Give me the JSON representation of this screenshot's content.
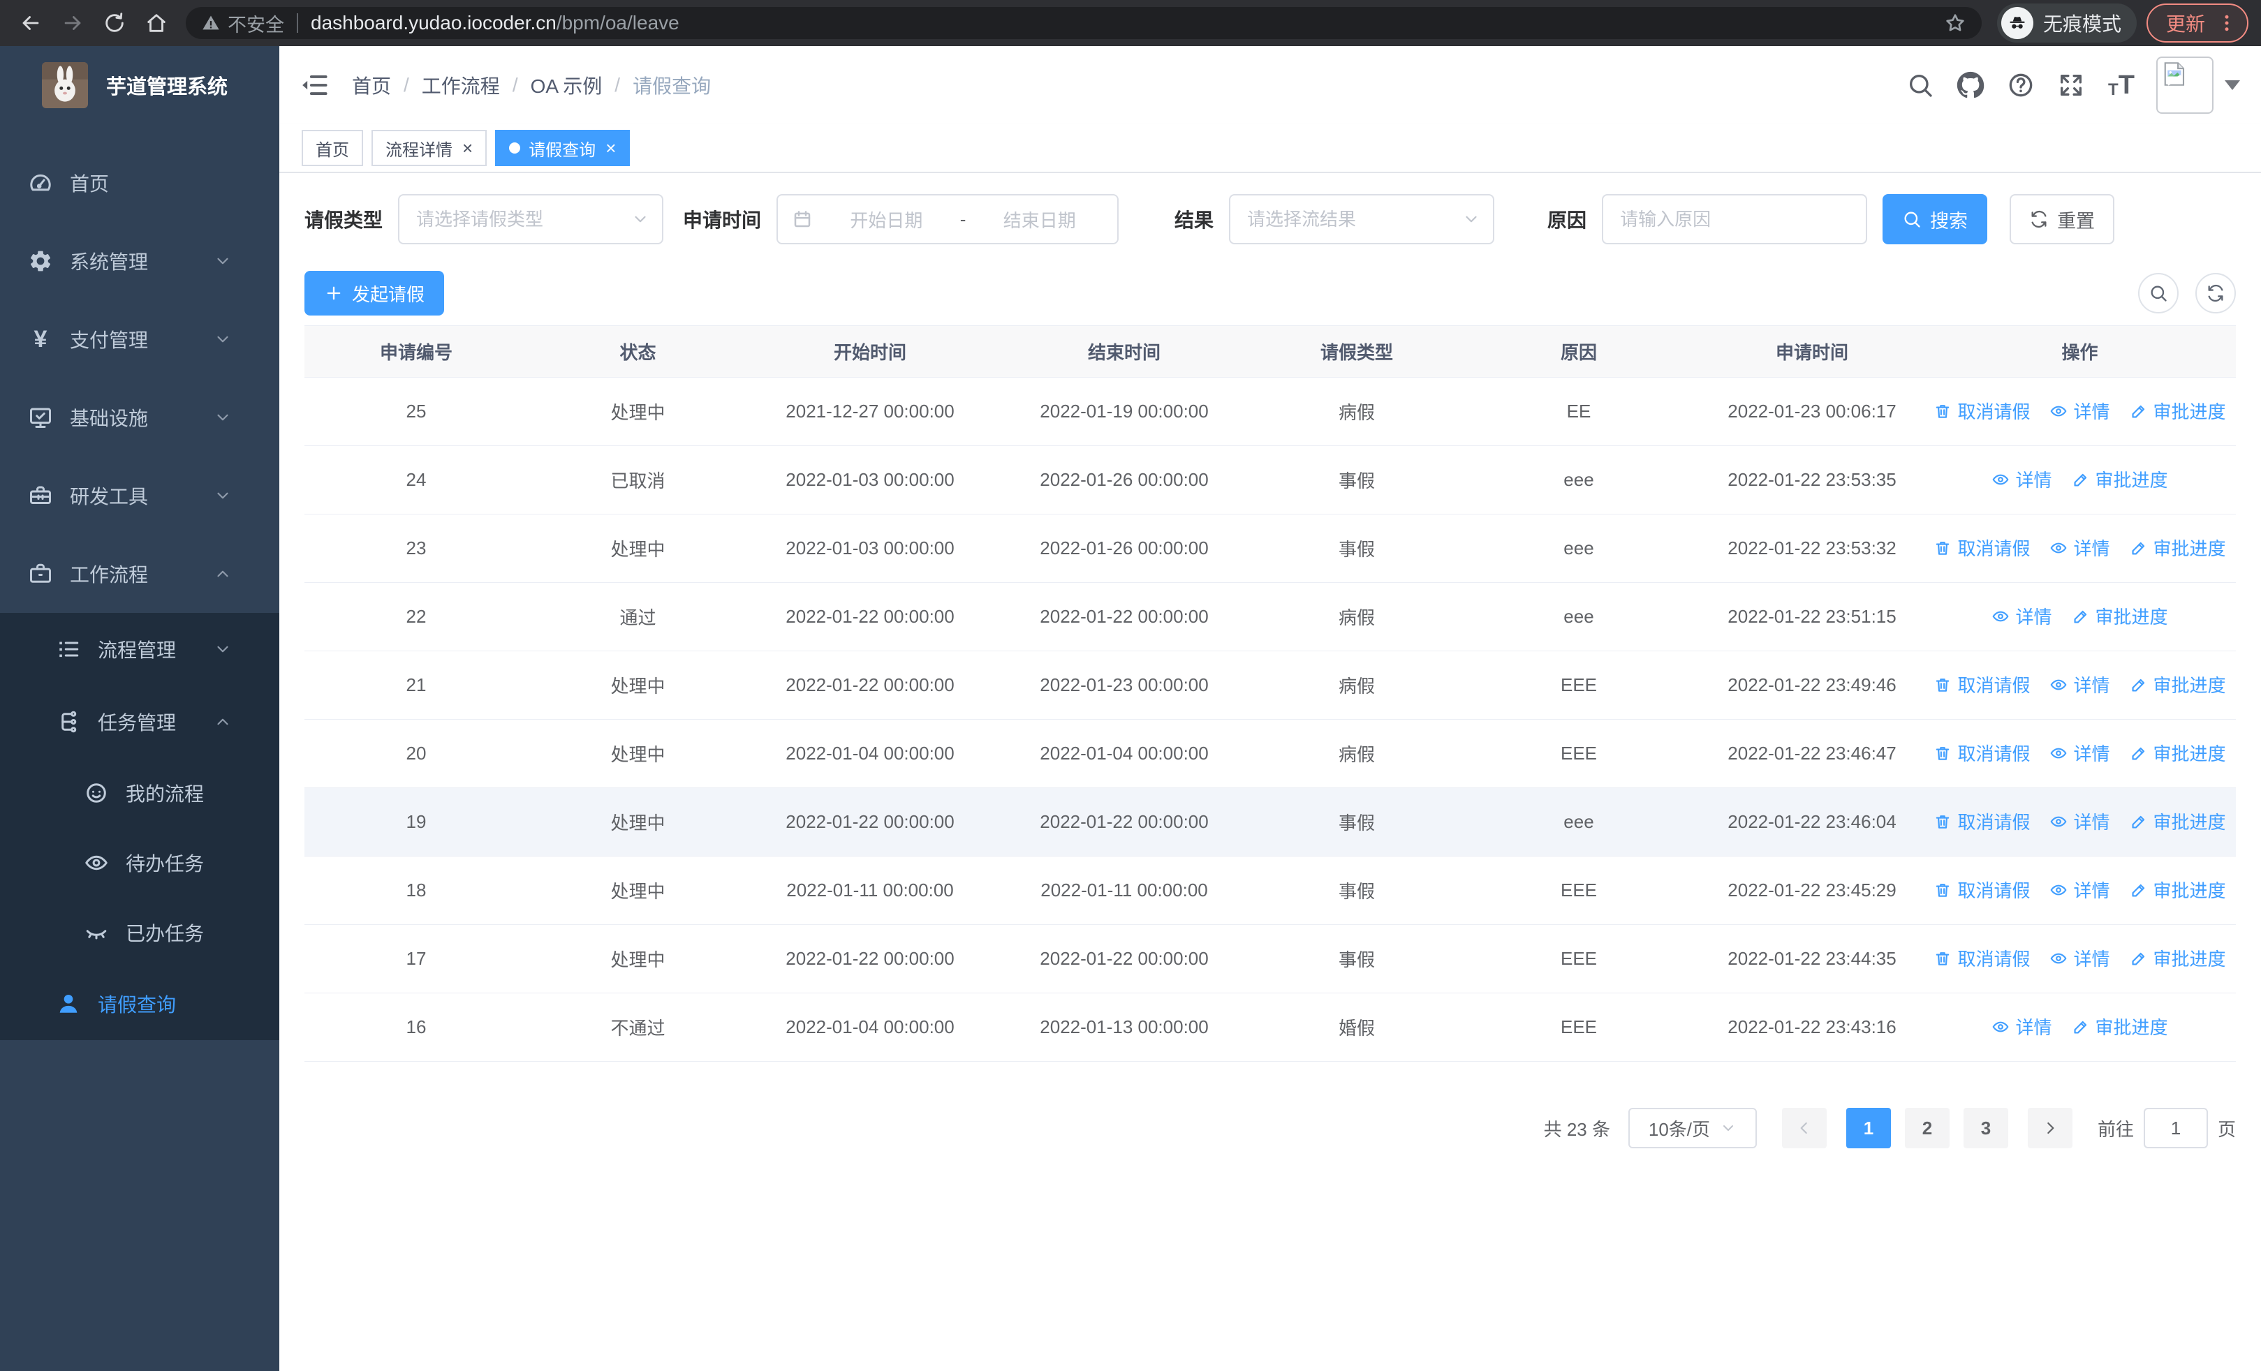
{
  "browser": {
    "security_label": "不安全",
    "url_host": "dashboard.yudao.iocoder.cn",
    "url_path": "/bpm/oa/leave",
    "incognito_label": "无痕模式",
    "update_label": "更新"
  },
  "sidebar": {
    "title": "芋道管理系统",
    "items": [
      {
        "label": "首页",
        "icon": "dashboard-icon",
        "level": 1,
        "submenu": false,
        "active": false,
        "chevron": ""
      },
      {
        "label": "系统管理",
        "icon": "gear-icon",
        "level": 1,
        "submenu": false,
        "active": false,
        "chevron": "down"
      },
      {
        "label": "支付管理",
        "icon": "yen-icon",
        "level": 1,
        "submenu": false,
        "active": false,
        "chevron": "down"
      },
      {
        "label": "基础设施",
        "icon": "monitor-icon",
        "level": 1,
        "submenu": false,
        "active": false,
        "chevron": "down"
      },
      {
        "label": "研发工具",
        "icon": "toolbox-icon",
        "level": 1,
        "submenu": false,
        "active": false,
        "chevron": "down"
      },
      {
        "label": "工作流程",
        "icon": "briefcase-icon",
        "level": 1,
        "submenu": false,
        "active": false,
        "chevron": "up"
      },
      {
        "label": "流程管理",
        "icon": "list-tree-icon",
        "level": 2,
        "submenu": true,
        "active": false,
        "chevron": "down"
      },
      {
        "label": "任务管理",
        "icon": "flow-icon",
        "level": 2,
        "submenu": true,
        "active": false,
        "chevron": "up"
      },
      {
        "label": "我的流程",
        "icon": "face-icon",
        "level": 3,
        "submenu": true,
        "active": false,
        "chevron": ""
      },
      {
        "label": "待办任务",
        "icon": "eye-icon",
        "level": 3,
        "submenu": true,
        "active": false,
        "chevron": ""
      },
      {
        "label": "已办任务",
        "icon": "eye-closed-icon",
        "level": 3,
        "submenu": true,
        "active": false,
        "chevron": ""
      },
      {
        "label": "请假查询",
        "icon": "user-icon",
        "level": 2,
        "submenu": true,
        "active": true,
        "chevron": ""
      }
    ]
  },
  "navbar": {
    "breadcrumb": [
      "首页",
      "工作流程",
      "OA 示例",
      "请假查询"
    ],
    "icons": [
      "search-icon",
      "github-icon",
      "help-icon",
      "fullscreen-icon",
      "font-size-icon"
    ]
  },
  "tabs": [
    {
      "label": "首页",
      "closable": false,
      "active": false
    },
    {
      "label": "流程详情",
      "closable": true,
      "active": false
    },
    {
      "label": "请假查询",
      "closable": true,
      "active": true
    }
  ],
  "filters": {
    "leave_type": {
      "label": "请假类型",
      "placeholder": "请选择请假类型"
    },
    "apply_time": {
      "label": "申请时间",
      "start_placeholder": "开始日期",
      "separator": "-",
      "end_placeholder": "结束日期"
    },
    "result": {
      "label": "结果",
      "placeholder": "请选择流结果"
    },
    "reason": {
      "label": "原因",
      "placeholder": "请输入原因"
    },
    "search_label": "搜索",
    "reset_label": "重置"
  },
  "toolbar": {
    "create_label": "发起请假"
  },
  "table": {
    "columns": [
      "申请编号",
      "状态",
      "开始时间",
      "结束时间",
      "请假类型",
      "原因",
      "申请时间",
      "操作"
    ],
    "action_labels": {
      "cancel": {
        "label": "取消请假",
        "icon": "trash-icon"
      },
      "detail": {
        "label": "详情",
        "icon": "eye-icon"
      },
      "progress": {
        "label": "审批进度",
        "icon": "edit-icon"
      }
    },
    "rows": [
      {
        "id": "25",
        "status": "处理中",
        "start": "2021-12-27 00:00:00",
        "end": "2022-01-19 00:00:00",
        "type": "病假",
        "reason": "EE",
        "apply_time": "2022-01-23 00:06:17",
        "actions": [
          "cancel",
          "detail",
          "progress"
        ],
        "highlight": false
      },
      {
        "id": "24",
        "status": "已取消",
        "start": "2022-01-03 00:00:00",
        "end": "2022-01-26 00:00:00",
        "type": "事假",
        "reason": "eee",
        "apply_time": "2022-01-22 23:53:35",
        "actions": [
          "detail",
          "progress"
        ],
        "highlight": false
      },
      {
        "id": "23",
        "status": "处理中",
        "start": "2022-01-03 00:00:00",
        "end": "2022-01-26 00:00:00",
        "type": "事假",
        "reason": "eee",
        "apply_time": "2022-01-22 23:53:32",
        "actions": [
          "cancel",
          "detail",
          "progress"
        ],
        "highlight": false
      },
      {
        "id": "22",
        "status": "通过",
        "start": "2022-01-22 00:00:00",
        "end": "2022-01-22 00:00:00",
        "type": "病假",
        "reason": "eee",
        "apply_time": "2022-01-22 23:51:15",
        "actions": [
          "detail",
          "progress"
        ],
        "highlight": false
      },
      {
        "id": "21",
        "status": "处理中",
        "start": "2022-01-22 00:00:00",
        "end": "2022-01-23 00:00:00",
        "type": "病假",
        "reason": "EEE",
        "apply_time": "2022-01-22 23:49:46",
        "actions": [
          "cancel",
          "detail",
          "progress"
        ],
        "highlight": false
      },
      {
        "id": "20",
        "status": "处理中",
        "start": "2022-01-04 00:00:00",
        "end": "2022-01-04 00:00:00",
        "type": "病假",
        "reason": "EEE",
        "apply_time": "2022-01-22 23:46:47",
        "actions": [
          "cancel",
          "detail",
          "progress"
        ],
        "highlight": false
      },
      {
        "id": "19",
        "status": "处理中",
        "start": "2022-01-22 00:00:00",
        "end": "2022-01-22 00:00:00",
        "type": "事假",
        "reason": "eee",
        "apply_time": "2022-01-22 23:46:04",
        "actions": [
          "cancel",
          "detail",
          "progress"
        ],
        "highlight": true
      },
      {
        "id": "18",
        "status": "处理中",
        "start": "2022-01-11 00:00:00",
        "end": "2022-01-11 00:00:00",
        "type": "事假",
        "reason": "EEE",
        "apply_time": "2022-01-22 23:45:29",
        "actions": [
          "cancel",
          "detail",
          "progress"
        ],
        "highlight": false
      },
      {
        "id": "17",
        "status": "处理中",
        "start": "2022-01-22 00:00:00",
        "end": "2022-01-22 00:00:00",
        "type": "事假",
        "reason": "EEE",
        "apply_time": "2022-01-22 23:44:35",
        "actions": [
          "cancel",
          "detail",
          "progress"
        ],
        "highlight": false
      },
      {
        "id": "16",
        "status": "不通过",
        "start": "2022-01-04 00:00:00",
        "end": "2022-01-13 00:00:00",
        "type": "婚假",
        "reason": "EEE",
        "apply_time": "2022-01-22 23:43:16",
        "actions": [
          "detail",
          "progress"
        ],
        "highlight": false
      }
    ]
  },
  "pagination": {
    "total_label": "共 23 条",
    "page_size": "10条/页",
    "pages": [
      "1",
      "2",
      "3"
    ],
    "active_page": "1",
    "goto_label": "前往",
    "goto_value": "1",
    "page_unit": "页"
  },
  "colors": {
    "accent": "#409eff",
    "sidebar": "#304156",
    "sidebar_sub": "#1f2d3d",
    "update_badge": "#f28b82"
  }
}
